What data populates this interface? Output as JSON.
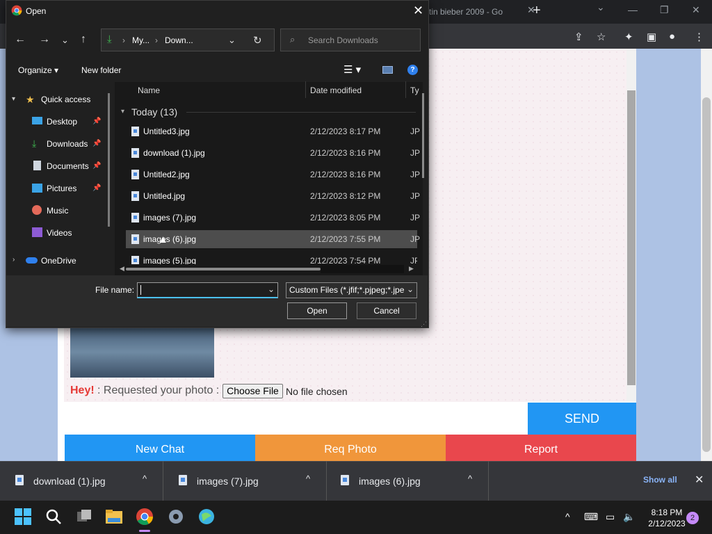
{
  "browser": {
    "inactive_tab_title": "tin bieber 2009 - Go",
    "tab_close": "✕",
    "new_tab": "+",
    "chevron": "⌄",
    "minimize": "—",
    "restore": "❐",
    "close": "✕"
  },
  "page": {
    "hey": "Hey!",
    "requested_text": ": Requested your photo :",
    "choose_file": "Choose File",
    "no_file": "No file chosen",
    "send": "SEND",
    "new_chat": "New Chat",
    "req_photo": "Req Photo",
    "report": "Report"
  },
  "downloads": {
    "items": [
      {
        "name": "download (1).jpg"
      },
      {
        "name": "images (7).jpg"
      },
      {
        "name": "images (6).jpg"
      }
    ],
    "caret": "^",
    "show_all": "Show all",
    "close": "✕"
  },
  "dialog": {
    "title": "Open",
    "close": "✕",
    "breadcrumb_1": "My...",
    "breadcrumb_sep": "›",
    "breadcrumb_2": "Down...",
    "search_placeholder": "Search Downloads",
    "organize": "Organize",
    "new_folder": "New folder",
    "help": "?",
    "nav": [
      {
        "label": "Quick access",
        "icon": "star-icon"
      },
      {
        "label": "Desktop",
        "icon": "desktop-icon"
      },
      {
        "label": "Downloads",
        "icon": "download-icon"
      },
      {
        "label": "Documents",
        "icon": "documents-icon"
      },
      {
        "label": "Pictures",
        "icon": "pictures-icon"
      },
      {
        "label": "Music",
        "icon": "music-icon"
      },
      {
        "label": "Videos",
        "icon": "videos-icon"
      },
      {
        "label": "OneDrive",
        "icon": "cloud-icon"
      }
    ],
    "columns": {
      "name": "Name",
      "date": "Date modified",
      "type": "Ty"
    },
    "group": "Today (13)",
    "files": [
      {
        "name": "Untitled3.jpg",
        "date": "2/12/2023 8:17 PM",
        "type": "JP"
      },
      {
        "name": "download (1).jpg",
        "date": "2/12/2023 8:16 PM",
        "type": "JP"
      },
      {
        "name": "Untitled2.jpg",
        "date": "2/12/2023 8:16 PM",
        "type": "JP"
      },
      {
        "name": "Untitled.jpg",
        "date": "2/12/2023 8:12 PM",
        "type": "JP"
      },
      {
        "name": "images (7).jpg",
        "date": "2/12/2023 8:05 PM",
        "type": "JP"
      },
      {
        "name": "images (6).jpg",
        "date": "2/12/2023 7:55 PM",
        "type": "JP"
      },
      {
        "name": "images (5).jpg",
        "date": "2/12/2023 7:54 PM",
        "type": "JP"
      }
    ],
    "file_name_label": "File name:",
    "file_name_value": "",
    "filter": "Custom Files (*.jfif;*.pjpeg;*.jpe",
    "open": "Open",
    "cancel": "Cancel"
  },
  "taskbar": {
    "time": "8:18 PM",
    "date": "2/12/2023",
    "notifications": "2"
  },
  "colors": {
    "send": "#2196f3",
    "req_photo": "#f0963b",
    "report": "#e9474d",
    "hey": "#e53935"
  }
}
